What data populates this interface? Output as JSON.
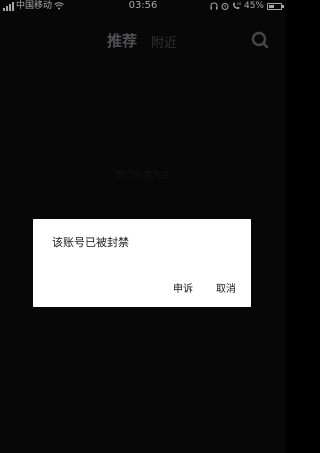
{
  "status_bar": {
    "carrier": "中国移动",
    "time": "03:56",
    "battery": "45%",
    "battery_level": 0.45,
    "icons": [
      "signal-icon",
      "wifi-icon",
      "headset-icon",
      "alarm-icon",
      "call-icon",
      "battery-icon"
    ]
  },
  "header": {
    "tab_recommend": "推荐",
    "tab_nearby": "附近",
    "search_icon": "search-icon"
  },
  "main": {
    "empty_text": "热门列表为空"
  },
  "dialog": {
    "message": "该账号已被封禁",
    "appeal_label": "申诉",
    "cancel_label": "取消"
  }
}
